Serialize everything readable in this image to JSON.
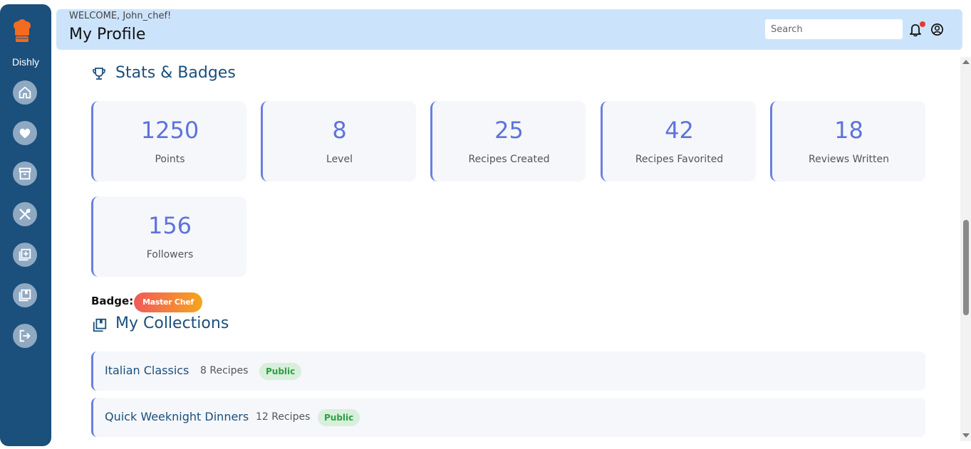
{
  "sidebar": {
    "brand": "Dishly",
    "items": [
      {
        "icon": "home-icon"
      },
      {
        "icon": "heart-icon"
      },
      {
        "icon": "archive-icon"
      },
      {
        "icon": "utensils-icon"
      },
      {
        "icon": "add-recipe-icon"
      },
      {
        "icon": "collections-icon"
      },
      {
        "icon": "logout-icon"
      }
    ]
  },
  "header": {
    "welcome": "WELCOME, John_chef!",
    "title": "My Profile",
    "search_placeholder": "Search"
  },
  "stats": {
    "title": "Stats & Badges",
    "cards": [
      {
        "value": "1250",
        "label": "Points"
      },
      {
        "value": "8",
        "label": "Level"
      },
      {
        "value": "25",
        "label": "Recipes Created"
      },
      {
        "value": "42",
        "label": "Recipes Favorited"
      },
      {
        "value": "18",
        "label": "Reviews Written"
      },
      {
        "value": "156",
        "label": "Followers"
      }
    ],
    "badge_label": "Badge:",
    "badge": "Master Chef"
  },
  "collections": {
    "title": "My Collections",
    "items": [
      {
        "name": "Italian Classics",
        "count": "8 Recipes",
        "visibility": "Public"
      },
      {
        "name": "Quick Weeknight Dinners",
        "count": "12 Recipes",
        "visibility": "Public"
      }
    ]
  },
  "colors": {
    "sidebar": "#1b4f7c",
    "header": "#cce4fb",
    "accent": "#5e73dc",
    "public_badge": "#2f9e45"
  }
}
